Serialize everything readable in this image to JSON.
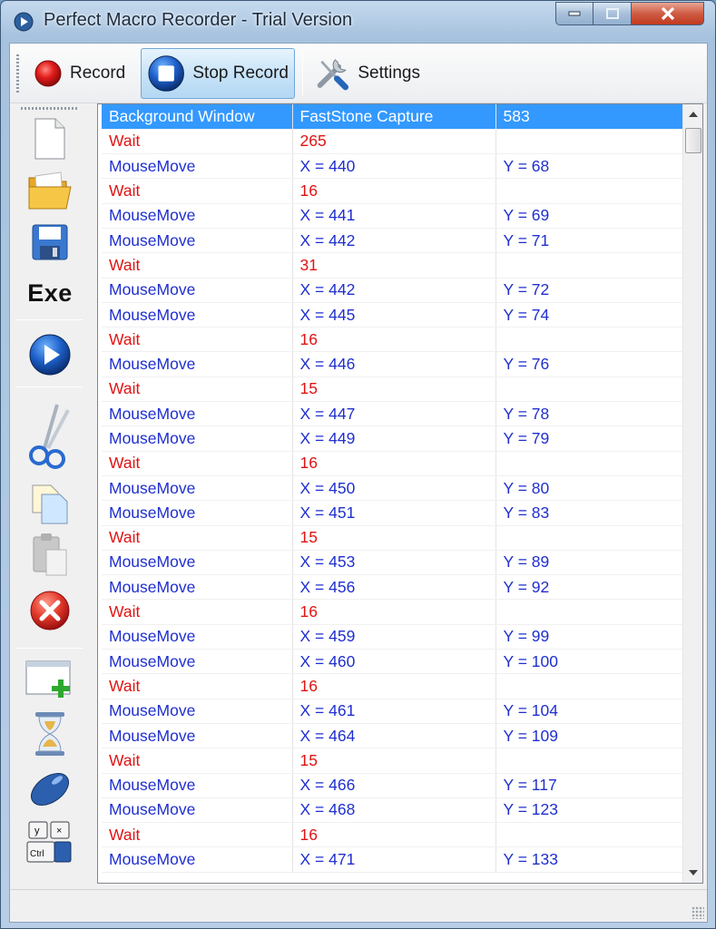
{
  "window": {
    "title": "Perfect Macro Recorder - Trial Version"
  },
  "toolbar": {
    "record_label": "Record",
    "stop_record_label": "Stop Record",
    "settings_label": "Settings"
  },
  "sidebar": {
    "items": [
      "new-file-icon",
      "open-folder-icon",
      "save-icon",
      "exe-icon",
      "play-icon",
      "cut-icon",
      "copy-icon",
      "paste-icon",
      "delete-icon",
      "add-window-icon",
      "hourglass-icon",
      "mouse-icon",
      "keyboard-icon"
    ],
    "exe_label": "Exe"
  },
  "colors": {
    "wait_text": "#e11313",
    "mousemove_text": "#1f2fcf",
    "selection": "#3399ff"
  },
  "macro_list": {
    "rows": [
      {
        "type": "sel",
        "c1": "Background Window",
        "c2": "FastStone Capture",
        "c3": "583"
      },
      {
        "type": "wait",
        "c1": "Wait",
        "c2": "265",
        "c3": ""
      },
      {
        "type": "move",
        "c1": "MouseMove",
        "c2": "X = 440",
        "c3": "Y = 68"
      },
      {
        "type": "wait",
        "c1": "Wait",
        "c2": "16",
        "c3": ""
      },
      {
        "type": "move",
        "c1": "MouseMove",
        "c2": "X = 441",
        "c3": "Y = 69"
      },
      {
        "type": "move",
        "c1": "MouseMove",
        "c2": "X = 442",
        "c3": "Y = 71"
      },
      {
        "type": "wait",
        "c1": "Wait",
        "c2": "31",
        "c3": ""
      },
      {
        "type": "move",
        "c1": "MouseMove",
        "c2": "X = 442",
        "c3": "Y = 72"
      },
      {
        "type": "move",
        "c1": "MouseMove",
        "c2": "X = 445",
        "c3": "Y = 74"
      },
      {
        "type": "wait",
        "c1": "Wait",
        "c2": "16",
        "c3": ""
      },
      {
        "type": "move",
        "c1": "MouseMove",
        "c2": "X = 446",
        "c3": "Y = 76"
      },
      {
        "type": "wait",
        "c1": "Wait",
        "c2": "15",
        "c3": ""
      },
      {
        "type": "move",
        "c1": "MouseMove",
        "c2": "X = 447",
        "c3": "Y = 78"
      },
      {
        "type": "move",
        "c1": "MouseMove",
        "c2": "X = 449",
        "c3": "Y = 79"
      },
      {
        "type": "wait",
        "c1": "Wait",
        "c2": "16",
        "c3": ""
      },
      {
        "type": "move",
        "c1": "MouseMove",
        "c2": "X = 450",
        "c3": "Y = 80"
      },
      {
        "type": "move",
        "c1": "MouseMove",
        "c2": "X = 451",
        "c3": "Y = 83"
      },
      {
        "type": "wait",
        "c1": "Wait",
        "c2": "15",
        "c3": ""
      },
      {
        "type": "move",
        "c1": "MouseMove",
        "c2": "X = 453",
        "c3": "Y = 89"
      },
      {
        "type": "move",
        "c1": "MouseMove",
        "c2": "X = 456",
        "c3": "Y = 92"
      },
      {
        "type": "wait",
        "c1": "Wait",
        "c2": "16",
        "c3": ""
      },
      {
        "type": "move",
        "c1": "MouseMove",
        "c2": "X = 459",
        "c3": "Y = 99"
      },
      {
        "type": "move",
        "c1": "MouseMove",
        "c2": "X = 460",
        "c3": "Y = 100"
      },
      {
        "type": "wait",
        "c1": "Wait",
        "c2": "16",
        "c3": ""
      },
      {
        "type": "move",
        "c1": "MouseMove",
        "c2": "X = 461",
        "c3": "Y = 104"
      },
      {
        "type": "move",
        "c1": "MouseMove",
        "c2": "X = 464",
        "c3": "Y = 109"
      },
      {
        "type": "wait",
        "c1": "Wait",
        "c2": "15",
        "c3": ""
      },
      {
        "type": "move",
        "c1": "MouseMove",
        "c2": "X = 466",
        "c3": "Y = 117"
      },
      {
        "type": "move",
        "c1": "MouseMove",
        "c2": "X = 468",
        "c3": "Y = 123"
      },
      {
        "type": "wait",
        "c1": "Wait",
        "c2": "16",
        "c3": ""
      },
      {
        "type": "move",
        "c1": "MouseMove",
        "c2": "X = 471",
        "c3": "Y = 133"
      }
    ]
  }
}
